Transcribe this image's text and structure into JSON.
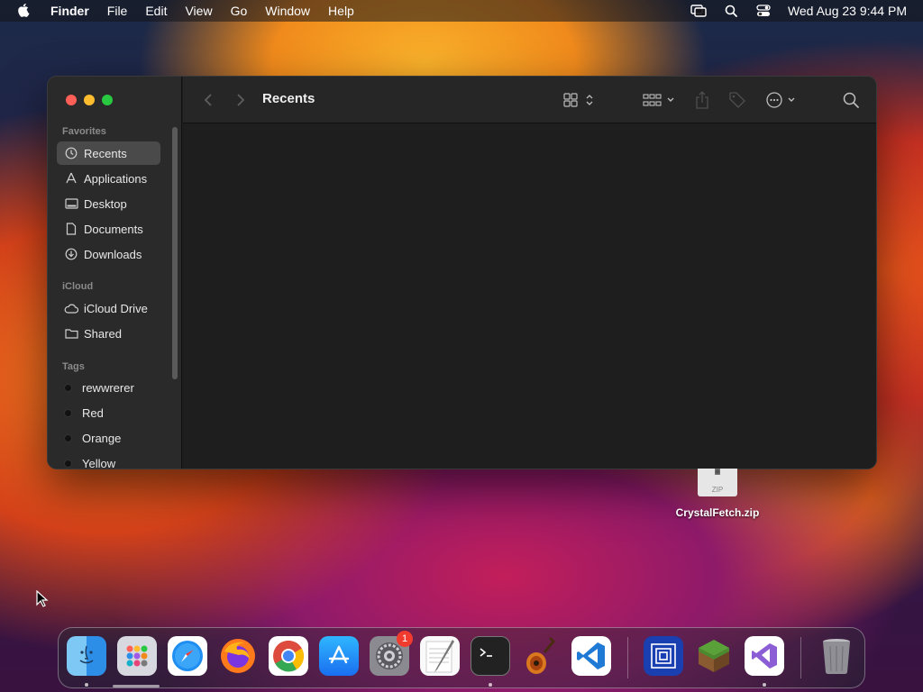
{
  "menubar": {
    "app_name": "Finder",
    "menus": [
      "File",
      "Edit",
      "View",
      "Go",
      "Window",
      "Help"
    ],
    "clock": "Wed Aug 23  9:44 PM"
  },
  "finder": {
    "title": "Recents",
    "sidebar": {
      "favorites_header": "Favorites",
      "favorites": [
        "Recents",
        "Applications",
        "Desktop",
        "Documents",
        "Downloads"
      ],
      "icloud_header": "iCloud",
      "icloud": [
        "iCloud Drive",
        "Shared"
      ],
      "tags_header": "Tags",
      "tags": [
        "rewwrerer",
        "Red",
        "Orange",
        "Yellow"
      ]
    }
  },
  "desktop": {
    "file_name": "CrystalFetch.zip",
    "file_type_label": "ZIP"
  },
  "dock": {
    "apps": [
      "Finder",
      "Launchpad",
      "Safari",
      "Firefox",
      "Chrome",
      "App Store",
      "System Settings",
      "TextEdit",
      "Terminal",
      "GarageBand",
      "Visual Studio Code",
      "Simulator",
      "Minecraft",
      "Visual Studio",
      "Trash"
    ],
    "settings_badge": "1"
  },
  "colors": {
    "traffic_close": "#ff5f57",
    "traffic_minimize": "#febc2e",
    "traffic_maximize": "#28c840",
    "sidebar_selected": "#4a4a4a"
  }
}
